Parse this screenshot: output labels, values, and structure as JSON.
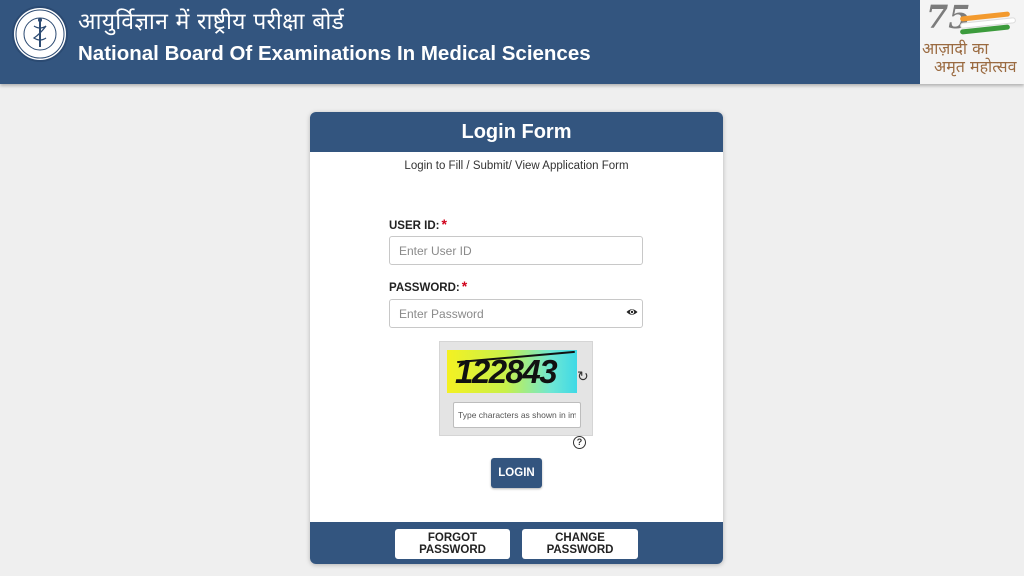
{
  "header": {
    "title_hindi": "आयुर्विज्ञान में राष्ट्रीय परीक्षा बोर्ड",
    "title_english": "National Board Of Examinations In Medical Sciences",
    "logo_icon": "nbems-emblem-icon",
    "amrit_mahotsav": {
      "number": "75",
      "line1": "आज़ादी का",
      "line2": "अमृत महोत्सव"
    }
  },
  "form": {
    "title": "Login Form",
    "subtitle": "Login to Fill / Submit/ View Application Form",
    "user_id": {
      "label": "USER ID:",
      "required_mark": "*",
      "placeholder": "Enter User ID",
      "value": ""
    },
    "password": {
      "label": "PASSWORD:",
      "required_mark": "*",
      "placeholder": "Enter Password",
      "value": "",
      "toggle_icon": "eye-icon"
    },
    "captcha": {
      "text": "122843",
      "refresh_icon": "refresh-icon",
      "placeholder": "Type characters as shown in image",
      "help_icon": "question-circle-icon",
      "help_glyph": "?"
    },
    "login_label": "LOGIN",
    "forgot_password_label": "FORGOT PASSWORD",
    "change_password_label": "CHANGE PASSWORD"
  },
  "colors": {
    "primary": "#33557f",
    "background": "#efefef",
    "required": "#d0021b"
  }
}
